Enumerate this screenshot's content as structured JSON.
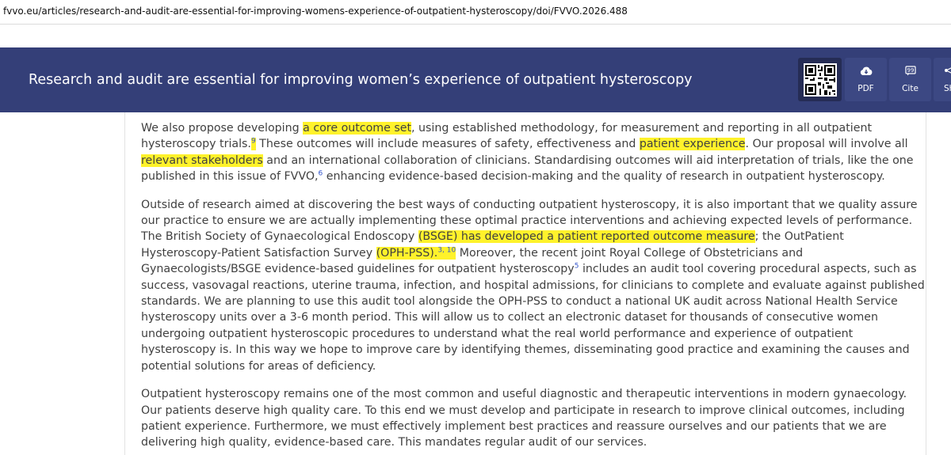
{
  "browser": {
    "url": "fvvo.eu/articles/research-and-audit-are-essential-for-improving-womens-experience-of-outpatient-hysteroscopy/doi/FVVO.2026.488"
  },
  "header": {
    "title": "Research and audit are essential for improving women’s experience of outpatient hysteroscopy",
    "buttons": {
      "pdf_label": "PDF",
      "cite_label": "Cite",
      "share_label": "Sh"
    },
    "colors": {
      "bar": "#343f78",
      "button": "#3c4883",
      "qr_bg": "#252c55"
    }
  },
  "article": {
    "highlight_color": "#fff22b",
    "link_color": "#3355cc",
    "p1": {
      "t1": "We also propose developing ",
      "h1": "a core outcome set",
      "t2": ", using established methodology, for measurement and reporting in all outpatient hysteroscopy trials.",
      "r1": "9",
      "t3": " These outcomes will include measures of safety, effectiveness and ",
      "h2": "patient experience",
      "t4": ". Our proposal will involve all ",
      "h3": "relevant stakeholders",
      "t5": " and an international collaboration of clinicians. Standardising outcomes will aid interpretation of trials, like the one published in this issue of FVVO,",
      "r2": "6",
      "t6": " enhancing evidence-based decision-making and the quality of research in outpatient hysteroscopy."
    },
    "p2": {
      "t1": "Outside of research aimed at discovering the best ways of conducting outpatient hysteroscopy, it is also important that we quality assure our practice to ensure we are actually implementing these optimal practice interventions and achieving expected levels of performance. The British Society of Gynaecological Endoscopy ",
      "h1": "(BSGE) has developed a patient reported outcome measure",
      "t2": "; the OutPatient Hysteroscopy-Patient Satisfaction Survey ",
      "h2": "(OPH-PSS).",
      "r1": "3, 10",
      "t3": " Moreover, the recent joint Royal College of Obstetricians and Gynaecologists/BSGE evidence-based guidelines for outpatient hysteroscopy",
      "r2": "5",
      "t4": " includes an audit tool covering procedural aspects, such as success, vasovagal reactions, uterine trauma, infection, and hospital admissions, for clinicians to complete and evaluate against published standards. We are planning to use this audit tool alongside the OPH-PSS to conduct a national UK audit across National Health Service hysteroscopy units over a 3-6 month period. This will allow us to collect an electronic dataset for thousands of consecutive women undergoing outpatient hysteroscopic procedures to understand what the real world performance and experience of outpatient hysteroscopy is. In this way we hope to improve care by identifying themes, disseminating good practice and examining the causes and potential solutions for areas of deficiency."
    },
    "p3": {
      "t1": "Outpatient hysteroscopy remains one of the most common and useful diagnostic and therapeutic interventions in modern gynaecology. Our patients deserve high quality care. To this end we must develop and participate in research to improve clinical outcomes, including patient experience. Furthermore, we must effectively implement best practices and reassure ourselves and our patients that we are delivering high quality, evidence-based care. This mandates regular audit of our services."
    }
  }
}
